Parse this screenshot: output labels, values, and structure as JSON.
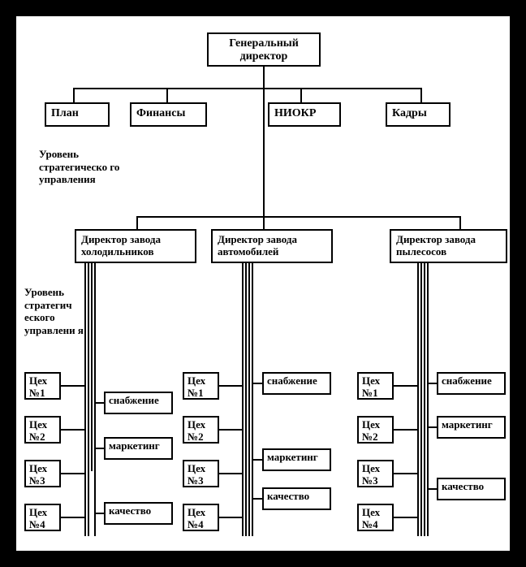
{
  "top": {
    "ceo": "Генеральный директор",
    "dept": [
      "План",
      "Финансы",
      "НИОКР",
      "Кадры"
    ]
  },
  "labels": {
    "strat1": "Уровень стратегическо го управления",
    "strat2": "Уровень стратегич еского управлени я"
  },
  "directors": [
    "Директор завода холодильников",
    "Директор завода автомобилей",
    "Директор завода пылесосов"
  ],
  "workshops": [
    "Цех №1",
    "Цех №2",
    "Цех №3",
    "Цех №4"
  ],
  "funcs": [
    "снабжение",
    "маркетинг",
    "качество"
  ]
}
